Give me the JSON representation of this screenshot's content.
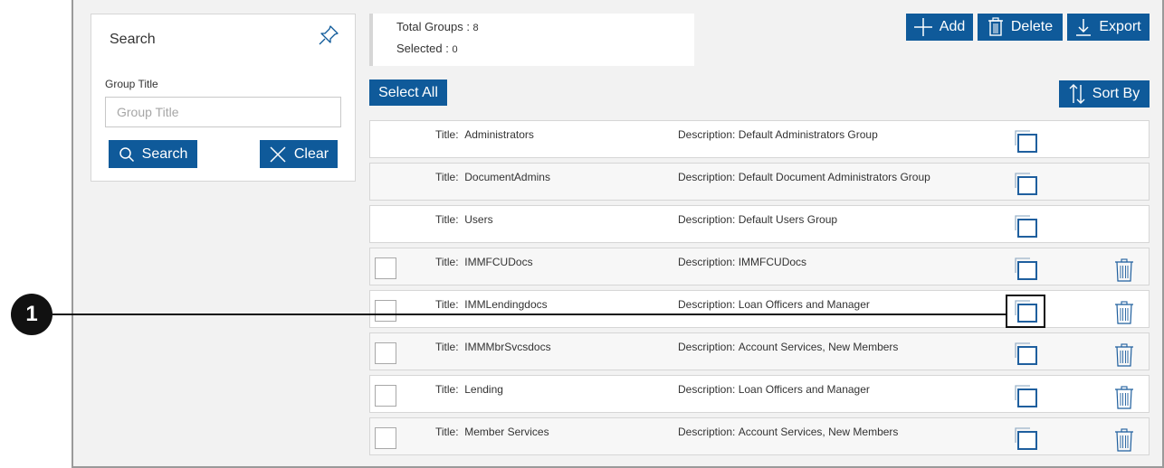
{
  "search_panel": {
    "title": "Search",
    "field_label": "Group Title",
    "field_placeholder": "Group Title",
    "field_value": "",
    "search_button": "Search",
    "clear_button": "Clear"
  },
  "summary": {
    "total_label": "Total Groups : ",
    "total_value": "8",
    "selected_label": "Selected : ",
    "selected_value": "0"
  },
  "toolbar": {
    "add": "Add",
    "delete": "Delete",
    "export": "Export",
    "select_all": "Select All",
    "sort_by": "Sort By"
  },
  "groups": [
    {
      "title_label": "Title:",
      "title": "Administrators",
      "desc_label": "Description:",
      "desc": "Default Administrators Group"
    },
    {
      "title_label": "Title:",
      "title": "DocumentAdmins",
      "desc_label": "Description:",
      "desc": "Default Document Administrators Group"
    },
    {
      "title_label": "Title:",
      "title": "Users",
      "desc_label": "Description:",
      "desc": "Default Users Group"
    },
    {
      "title_label": "Title:",
      "title": "IMMFCUDocs",
      "desc_label": "Description:",
      "desc": "IMMFCUDocs"
    },
    {
      "title_label": "Title:",
      "title": "IMMLendingdocs",
      "desc_label": "Description:",
      "desc": "Loan Officers and Manager"
    },
    {
      "title_label": "Title:",
      "title": "IMMMbrSvcsdocs",
      "desc_label": "Description:",
      "desc": "Account Services, New Members"
    },
    {
      "title_label": "Title:",
      "title": "Lending",
      "desc_label": "Description:",
      "desc": "Loan Officers and Manager"
    },
    {
      "title_label": "Title:",
      "title": "Member Services",
      "desc_label": "Description:",
      "desc": "Account Services, New Members"
    }
  ],
  "callout": {
    "number": "1"
  },
  "colors": {
    "accent": "#0f5a9a",
    "frame": "#f2f2f2"
  }
}
